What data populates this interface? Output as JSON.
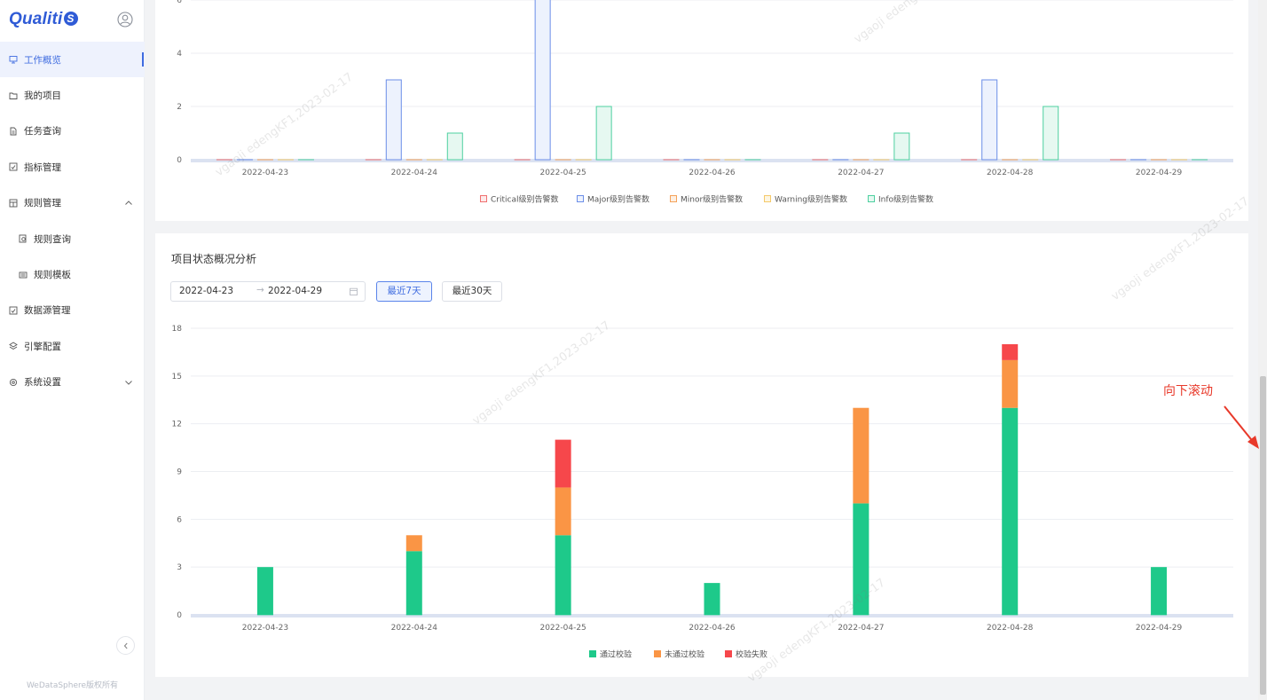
{
  "app": {
    "logo_text": "Qualiti",
    "logo_badge": "S",
    "copyright": "WeDataSphere版权所有"
  },
  "sidebar": {
    "items": [
      {
        "label": "工作概览",
        "icon": "monitor-icon",
        "active": true
      },
      {
        "label": "我的项目",
        "icon": "folder-icon"
      },
      {
        "label": "任务查询",
        "icon": "document-icon"
      },
      {
        "label": "指标管理",
        "icon": "chart-check-icon"
      },
      {
        "label": "规则管理",
        "icon": "rules-icon",
        "caret": "up"
      },
      {
        "label": "规则查询",
        "icon": "rule-query-icon",
        "sub": true
      },
      {
        "label": "规则模板",
        "icon": "template-icon",
        "sub": true
      },
      {
        "label": "数据源管理",
        "icon": "datasource-icon"
      },
      {
        "label": "引擎配置",
        "icon": "engine-icon"
      },
      {
        "label": "系统设置",
        "icon": "settings-icon",
        "caret": "down"
      }
    ]
  },
  "alarm_chart": {
    "chart_data": {
      "type": "bar",
      "categories": [
        "2022-04-23",
        "2022-04-24",
        "2022-04-25",
        "2022-04-26",
        "2022-04-27",
        "2022-04-28",
        "2022-04-29"
      ],
      "yticks": [
        "0",
        "2",
        "4",
        "6"
      ],
      "ylim": [
        0,
        6.6
      ],
      "series": [
        {
          "name": "Critical级别告警数",
          "color": "#f07070",
          "fill": "#fdeaea",
          "values": [
            0,
            0,
            0,
            0,
            0,
            0,
            0
          ]
        },
        {
          "name": "Major级别告警数",
          "color": "#6b8ee8",
          "fill": "#edf2fd",
          "values": [
            0,
            3,
            7,
            0,
            0,
            3,
            0
          ]
        },
        {
          "name": "Minor级别告警数",
          "color": "#f5a25a",
          "fill": "#fdf0e3",
          "values": [
            0,
            0,
            0,
            0,
            0,
            0,
            0
          ]
        },
        {
          "name": "Warning级别告警数",
          "color": "#f5c96a",
          "fill": "#fdf6e2",
          "values": [
            0,
            0,
            0,
            0,
            0,
            0,
            0
          ]
        },
        {
          "name": "Info级别告警数",
          "color": "#4dd0a0",
          "fill": "#e6f8f1",
          "values": [
            0,
            1,
            2,
            0,
            1,
            2,
            0
          ]
        }
      ],
      "grid": true,
      "legend": "bottom-center"
    }
  },
  "status_chart": {
    "title": "项目状态概况分析",
    "date_start": "2022-04-23",
    "date_sep": "→",
    "date_end": "2022-04-29",
    "btn_7days": "最近7天",
    "btn_30days": "最近30天",
    "chart_data": {
      "type": "bar",
      "stacked": true,
      "categories": [
        "2022-04-23",
        "2022-04-24",
        "2022-04-25",
        "2022-04-26",
        "2022-04-27",
        "2022-04-28",
        "2022-04-29"
      ],
      "yticks": [
        "0",
        "3",
        "6",
        "9",
        "12",
        "15",
        "18"
      ],
      "ylim": [
        0,
        18
      ],
      "series": [
        {
          "name": "通过校验",
          "color": "#1ec98a",
          "values": [
            3,
            4,
            5,
            2,
            7,
            13,
            3
          ]
        },
        {
          "name": "未通过校验",
          "color": "#fa9545",
          "values": [
            0,
            1,
            3,
            0,
            6,
            3,
            0
          ]
        },
        {
          "name": "校验失败",
          "color": "#f6474b",
          "values": [
            0,
            0,
            3,
            0,
            0,
            1,
            0
          ]
        }
      ],
      "grid": true,
      "legend": "bottom-center"
    }
  },
  "annotation": {
    "text": "向下滚动",
    "color": "#e8392a"
  },
  "watermark": {
    "text": "vgaoji edengKF1,2023-02-17"
  }
}
